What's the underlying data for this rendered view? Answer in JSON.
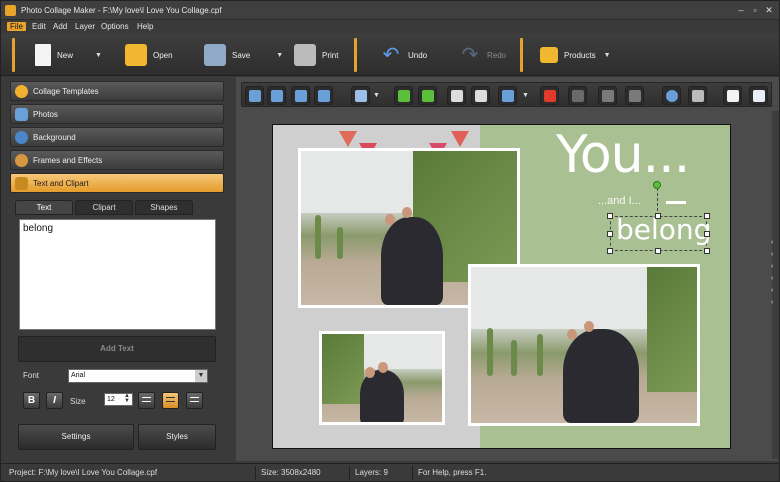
{
  "window": {
    "title": "Photo Collage Maker - F:\\My love\\I Love You Collage.cpf"
  },
  "menu": [
    "File",
    "Edit",
    "Add",
    "Layer",
    "Options",
    "Help"
  ],
  "toolbar": {
    "new_label": "New",
    "open_label": "Open",
    "save_label": "Save",
    "print_label": "Print",
    "undo_label": "Undo",
    "redo_label": "Redo",
    "products_label": "Products"
  },
  "sidebar": {
    "items": [
      {
        "label": "Collage Templates",
        "icon": "star-icon",
        "color": "#f0b030"
      },
      {
        "label": "Photos",
        "icon": "photo-icon",
        "color": "#6aa0d8"
      },
      {
        "label": "Background",
        "icon": "globe-icon",
        "color": "#4a86c8"
      },
      {
        "label": "Frames and Effects",
        "icon": "palette-icon",
        "color": "#d89640"
      },
      {
        "label": "Text and Clipart",
        "icon": "text-t-icon",
        "color": "#c88a20"
      }
    ]
  },
  "text_panel": {
    "tabs": [
      "Text",
      "Clipart",
      "Shapes"
    ],
    "text_value": "belong",
    "add_text_label": "Add Text",
    "font_label": "Font",
    "font_value": "Arial",
    "size_label": "Size",
    "size_value": "12",
    "settings_label": "Settings",
    "styles_label": "Styles"
  },
  "collage": {
    "headline": "You...",
    "subline": "...and I...",
    "selected_text": "belong"
  },
  "status": {
    "project": "Project: F:\\My love\\I Love You Collage.cpf",
    "size": "Size: 3508x2480",
    "layers": "Layers: 9",
    "help": "For Help, press F1."
  },
  "colors": {
    "accent": "#e9a52b",
    "canvas_green": "#a8c092"
  }
}
